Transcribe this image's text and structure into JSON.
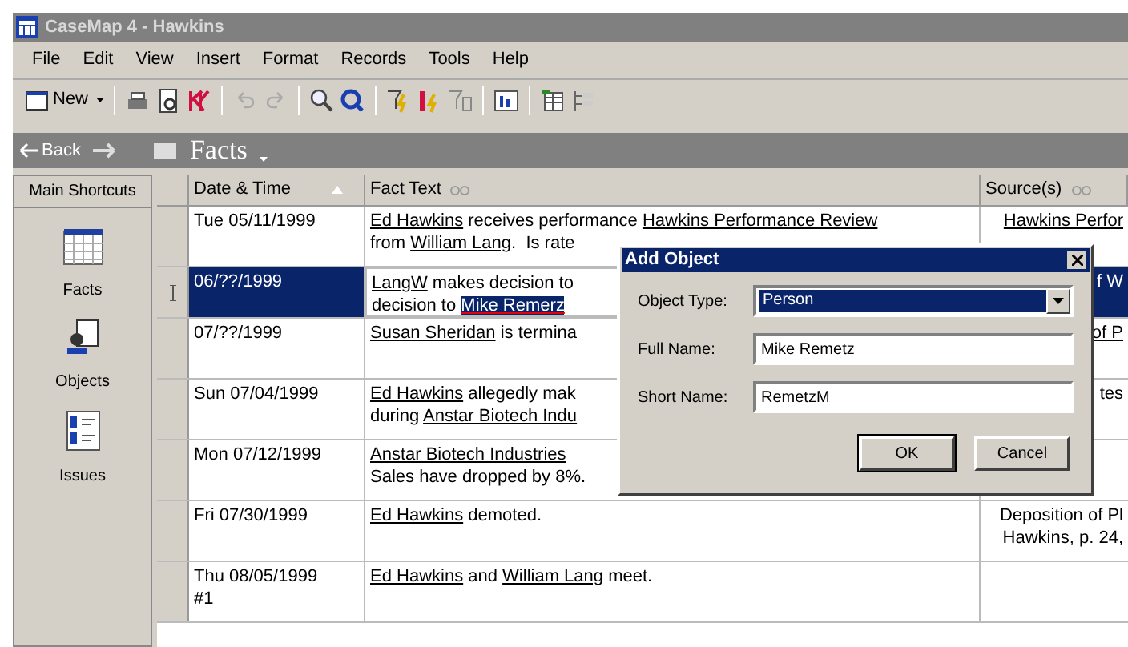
{
  "window": {
    "title": "CaseMap 4 - Hawkins"
  },
  "menu": [
    "File",
    "Edit",
    "View",
    "Insert",
    "Format",
    "Records",
    "Tools",
    "Help"
  ],
  "toolbar": {
    "new_label": "New"
  },
  "nav": {
    "back": "Back",
    "location": "Facts"
  },
  "sidebar": {
    "title": "Main Shortcuts",
    "items": [
      {
        "kind": "calendar",
        "label": "Facts"
      },
      {
        "kind": "person",
        "label": "Objects"
      },
      {
        "kind": "list",
        "label": "Issues"
      }
    ]
  },
  "table": {
    "columns": [
      "Date & Time",
      "Fact Text",
      "Source(s)"
    ],
    "rows": [
      {
        "selected": false,
        "date": [
          "Tue 05/11/1999"
        ],
        "fact": [
          [
            {
              "kind": "link",
              "text": "Ed Hawkins"
            },
            {
              "kind": "plain",
              "text": " receives performance "
            },
            {
              "kind": "link",
              "text": "Hawkins Performance Review"
            }
          ],
          [
            {
              "kind": "plain",
              "text": "from "
            },
            {
              "kind": "link",
              "text": "William Lang"
            },
            {
              "kind": "plain",
              "text": ".  Is rate"
            }
          ]
        ],
        "source": [
          [
            {
              "kind": "link",
              "text": "Hawkins Perfor"
            }
          ]
        ]
      },
      {
        "selected": true,
        "date": [
          "06/??/1999"
        ],
        "fact": [
          [
            {
              "kind": "link",
              "text": "LangW"
            },
            {
              "kind": "plain",
              "text": " makes decision to"
            }
          ],
          [
            {
              "kind": "plain",
              "text": "decision to "
            },
            {
              "kind": "highlight",
              "text": "Mike Remerz"
            }
          ]
        ],
        "source": [
          [
            {
              "kind": "plain",
              "text": "f W"
            }
          ]
        ]
      },
      {
        "selected": false,
        "date": [
          "07/??/1999"
        ],
        "fact": [
          [
            {
              "kind": "link",
              "text": "Susan Sheridan"
            },
            {
              "kind": "plain",
              "text": " is termina"
            }
          ]
        ],
        "source": [
          [
            {
              "kind": "link",
              "text": "of P"
            }
          ]
        ]
      },
      {
        "selected": false,
        "date": [
          "Sun 07/04/1999"
        ],
        "fact": [
          [
            {
              "kind": "link",
              "text": "Ed Hawkins"
            },
            {
              "kind": "plain",
              "text": " allegedly mak"
            }
          ],
          [
            {
              "kind": "plain",
              "text": "during "
            },
            {
              "kind": "link",
              "text": "Anstar Biotech Indu"
            }
          ]
        ],
        "source": [
          [
            {
              "kind": "plain",
              "text": "tes"
            }
          ]
        ]
      },
      {
        "selected": false,
        "date": [
          "Mon 07/12/1999"
        ],
        "fact": [
          [
            {
              "kind": "link",
              "text": "Anstar Biotech Industries"
            }
          ],
          [
            {
              "kind": "plain",
              "text": "Sales have dropped by 8%."
            }
          ]
        ],
        "source": []
      },
      {
        "selected": false,
        "date": [
          "Fri 07/30/1999"
        ],
        "fact": [
          [
            {
              "kind": "link",
              "text": "Ed Hawkins"
            },
            {
              "kind": "plain",
              "text": " demoted."
            }
          ]
        ],
        "source": [
          [
            {
              "kind": "plain",
              "text": "Deposition of Pl"
            }
          ],
          [
            {
              "kind": "plain",
              "text": "Hawkins, p. 24,"
            }
          ]
        ]
      },
      {
        "selected": false,
        "date": [
          "Thu 08/05/1999",
          "#1"
        ],
        "fact": [
          [
            {
              "kind": "link",
              "text": "Ed Hawkins"
            },
            {
              "kind": "plain",
              "text": " and "
            },
            {
              "kind": "link",
              "text": "William Lang"
            },
            {
              "kind": "plain",
              "text": " meet."
            }
          ]
        ],
        "source": []
      }
    ]
  },
  "dialog": {
    "title": "Add Object",
    "fields": [
      {
        "kind": "select",
        "label": "Object Type:",
        "value": "Person"
      },
      {
        "kind": "text",
        "label": "Full Name:",
        "value": "Mike Remetz"
      },
      {
        "kind": "text",
        "label": "Short Name:",
        "value": "RemetzM"
      }
    ],
    "buttons": [
      "OK",
      "Cancel"
    ]
  }
}
